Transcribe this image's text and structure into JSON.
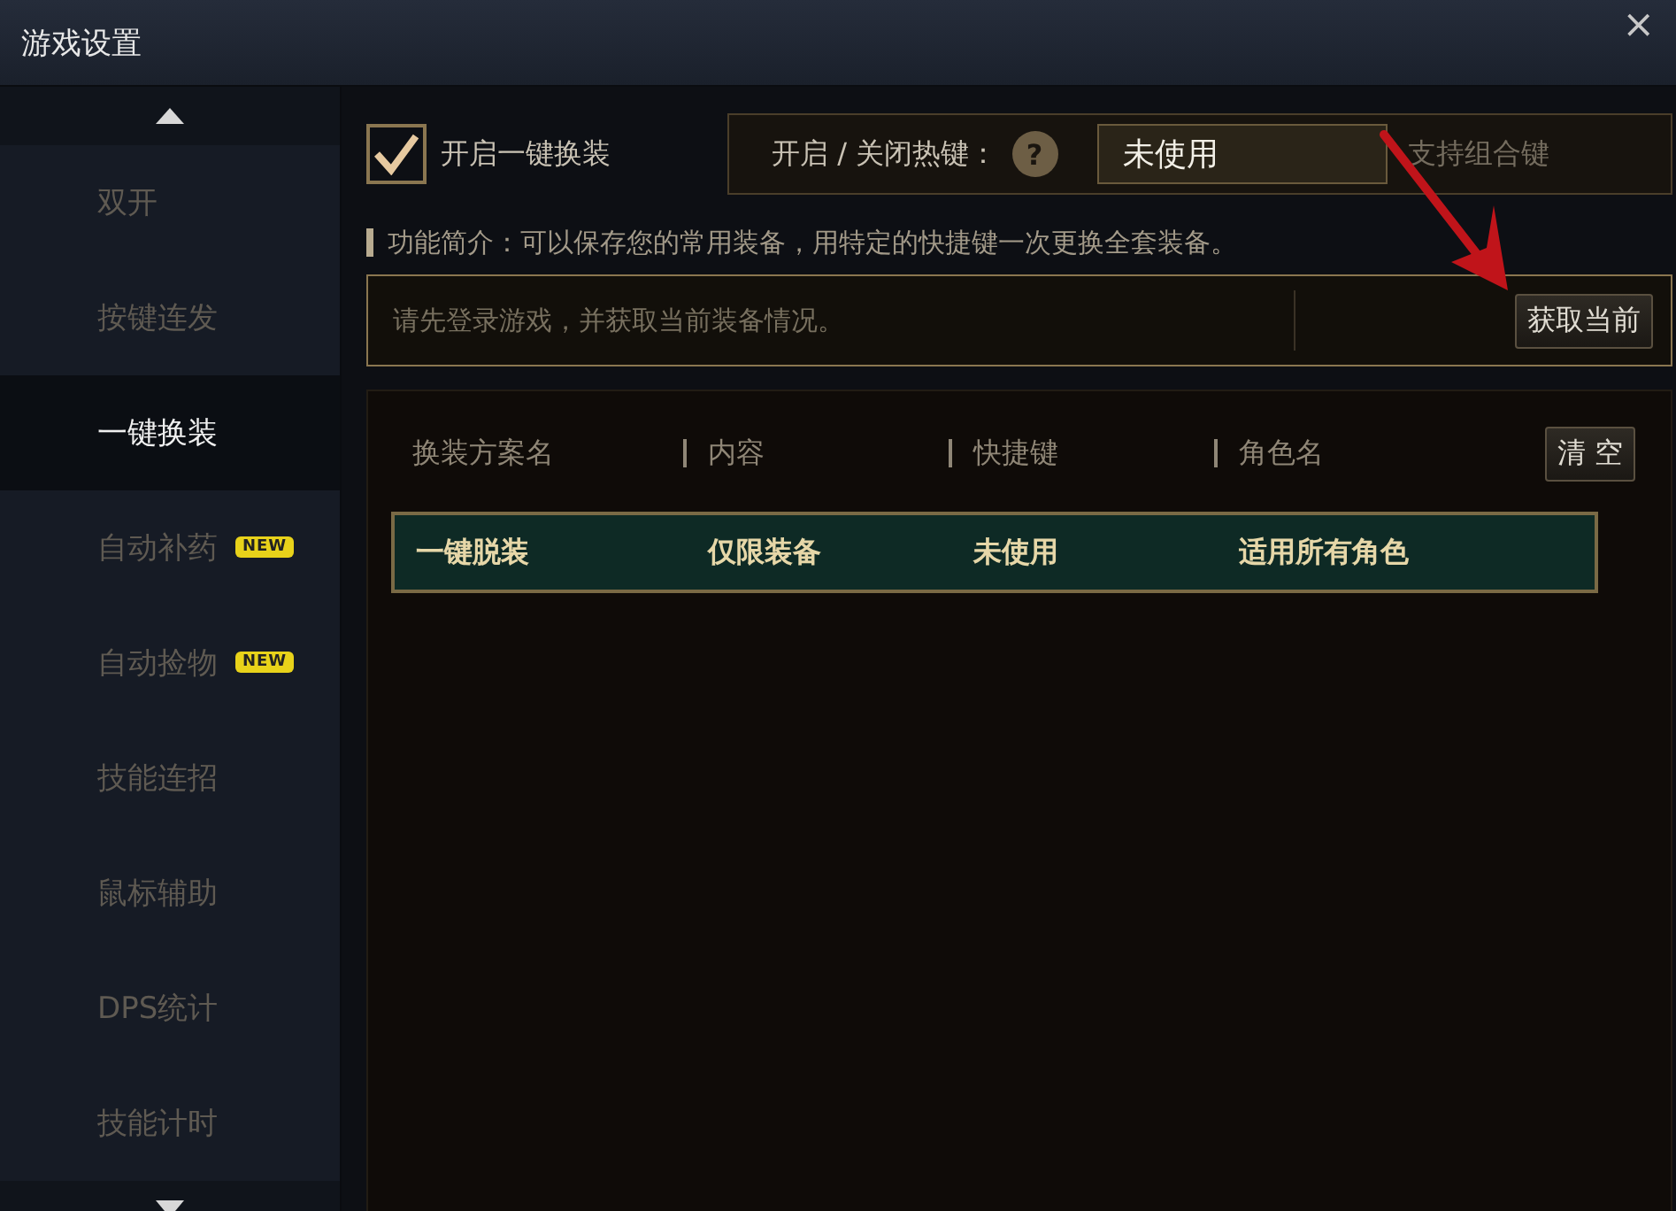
{
  "window": {
    "title": "游戏设置",
    "close": "×"
  },
  "sidebar": {
    "items": [
      {
        "label": "双开",
        "selected": false
      },
      {
        "label": "按键连发",
        "selected": false
      },
      {
        "label": "一键换装",
        "selected": true
      },
      {
        "label": "自动补药",
        "selected": false,
        "badge": "NEW"
      },
      {
        "label": "自动捡物",
        "selected": false,
        "badge": "NEW"
      },
      {
        "label": "技能连招",
        "selected": false
      },
      {
        "label": "鼠标辅助",
        "selected": false
      },
      {
        "label": "DPS统计",
        "selected": false
      },
      {
        "label": "技能计时",
        "selected": false
      }
    ]
  },
  "toggle": {
    "label": "开启一键换装",
    "checked": true
  },
  "hotkey": {
    "label": "开启 / 关闭热键：",
    "help": "?",
    "value": "未使用",
    "note": "支持组合键"
  },
  "intro": "功能简介：可以保存您的常用装备，用特定的快捷键一次更换全套装备。",
  "info": {
    "message": "请先登录游戏，并获取当前装备情况。",
    "button": "获取当前"
  },
  "table": {
    "columns": [
      "换装方案名",
      "内容",
      "快捷键",
      "角色名"
    ],
    "clear_button": "清 空",
    "rows": [
      {
        "cells": [
          "一键脱装",
          "仅限装备",
          "未使用",
          "适用所有角色"
        ],
        "selected": true
      }
    ]
  }
}
